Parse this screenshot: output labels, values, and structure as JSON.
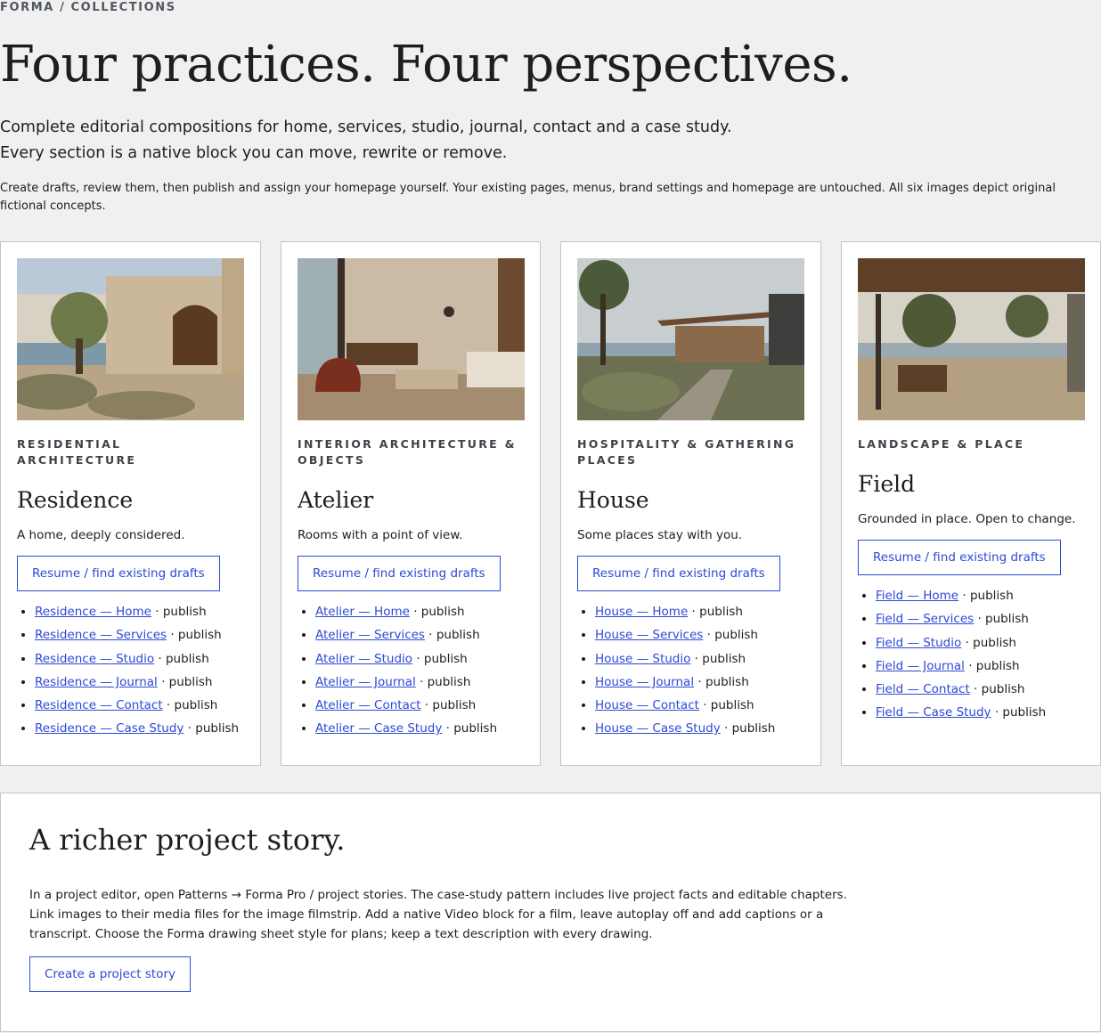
{
  "breadcrumb": "FORMA / COLLECTIONS",
  "hero": {
    "title": "Four practices. Four perspectives.",
    "lede_1": "Complete editorial compositions for home, services, studio, journal, contact and a case study.",
    "lede_2": "Every section is a native block you can move, rewrite or remove.",
    "note": "Create drafts, review them, then publish and assign your homepage yourself. Your existing pages, menus, brand settings and homepage are untouched. All six images depict original fictional concepts."
  },
  "collections": [
    {
      "category": "RESIDENTIAL ARCHITECTURE",
      "title": "Residence",
      "tagline": "A home, deeply considered.",
      "button": "Resume / find existing drafts",
      "image": "mediterranean-villa-image",
      "pages": [
        {
          "link": "Residence — Home",
          "action": " · publish"
        },
        {
          "link": "Residence — Services",
          "action": " · publish"
        },
        {
          "link": "Residence — Studio",
          "action": " · publish"
        },
        {
          "link": "Residence — Journal",
          "action": " · publish"
        },
        {
          "link": "Residence — Contact",
          "action": " · publish"
        },
        {
          "link": "Residence — Case Study",
          "action": " · publish"
        }
      ]
    },
    {
      "category": "INTERIOR ARCHITECTURE & OBJECTS",
      "title": "Atelier",
      "tagline": "Rooms with a point of view.",
      "button": "Resume / find existing drafts",
      "image": "living-room-interior-image",
      "pages": [
        {
          "link": "Atelier — Home",
          "action": " · publish"
        },
        {
          "link": "Atelier — Services",
          "action": " · publish"
        },
        {
          "link": "Atelier — Studio",
          "action": " · publish"
        },
        {
          "link": "Atelier — Journal",
          "action": " · publish"
        },
        {
          "link": "Atelier — Contact",
          "action": " · publish"
        },
        {
          "link": "Atelier — Case Study",
          "action": " · publish"
        }
      ]
    },
    {
      "category": "HOSPITALITY & GATHERING PLACES",
      "title": "House",
      "tagline": "Some places stay with you.",
      "button": "Resume / find existing drafts",
      "image": "coastal-pavilion-image",
      "pages": [
        {
          "link": "House — Home",
          "action": " · publish"
        },
        {
          "link": "House — Services",
          "action": " · publish"
        },
        {
          "link": "House — Studio",
          "action": " · publish"
        },
        {
          "link": "House — Journal",
          "action": " · publish"
        },
        {
          "link": "House — Contact",
          "action": " · publish"
        },
        {
          "link": "House — Case Study",
          "action": " · publish"
        }
      ]
    },
    {
      "category": "LANDSCAPE & PLACE",
      "title": "Field",
      "tagline": "Grounded in place. Open to change.",
      "button": "Resume / find existing drafts",
      "image": "timber-terrace-image",
      "pages": [
        {
          "link": "Field — Home",
          "action": " · publish"
        },
        {
          "link": "Field — Services",
          "action": " · publish"
        },
        {
          "link": "Field — Studio",
          "action": " · publish"
        },
        {
          "link": "Field — Journal",
          "action": " · publish"
        },
        {
          "link": "Field — Contact",
          "action": " · publish"
        },
        {
          "link": "Field — Case Study",
          "action": " · publish"
        }
      ]
    }
  ],
  "story": {
    "title": "A richer project story.",
    "text_1": "In a project editor, open Patterns → Forma Pro / project stories. The case-study pattern includes live project facts and editable chapters.",
    "text_2": "Link images to their media files for the image filmstrip. Add a native Video block for a film, leave autoplay off and add captions or a",
    "text_3": "transcript. Choose the Forma drawing sheet style for plans; keep a text description with every drawing.",
    "button": "Create a project story"
  },
  "colors": {
    "accent": "#2c49d6",
    "page_bg": "#f0f0f1",
    "card_border": "#c3c4c7"
  }
}
